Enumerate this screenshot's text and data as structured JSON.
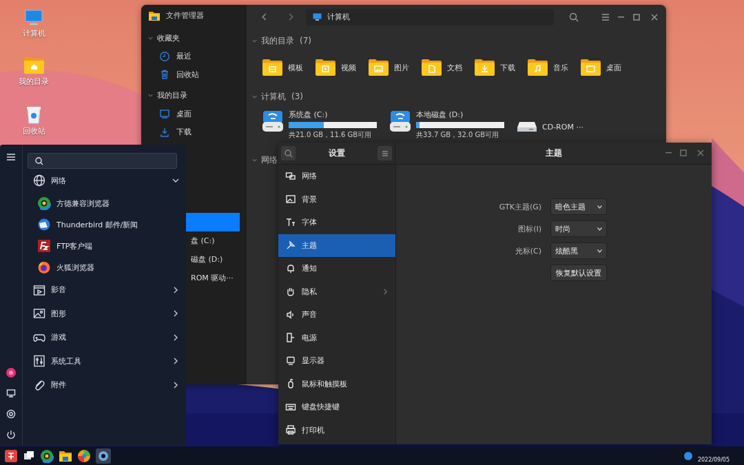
{
  "desktop_icons": [
    {
      "label": "计算机",
      "kind": "computer"
    },
    {
      "label": "我的目录",
      "kind": "home"
    },
    {
      "label": "回收站",
      "kind": "trash"
    }
  ],
  "file_manager": {
    "title": "文件管理器",
    "path": "计算机",
    "sidebar": [
      {
        "label": "收藏夹",
        "expanded": true,
        "children": [
          {
            "label": "最近",
            "kind": "recent"
          },
          {
            "label": "回收站",
            "kind": "trash"
          }
        ]
      },
      {
        "label": "我的目录",
        "expanded": true,
        "children": [
          {
            "label": "桌面",
            "kind": "desktop"
          },
          {
            "label": "下载",
            "kind": "download"
          }
        ]
      }
    ],
    "sidebar_partial": [
      {
        "selected": true
      },
      {
        "label": "盘 (C:)",
        "selected": false
      },
      {
        "label": "磁盘 (D:)",
        "selected": false
      },
      {
        "label": "ROM 驱动···",
        "selected": false
      }
    ],
    "sections": [
      {
        "title": "我的目录",
        "count": "(7)",
        "expanded": true,
        "folders": [
          {
            "label": "模板",
            "kind": "template"
          },
          {
            "label": "视频",
            "kind": "video"
          },
          {
            "label": "图片",
            "kind": "picture"
          },
          {
            "label": "文档",
            "kind": "document"
          },
          {
            "label": "下载",
            "kind": "download"
          },
          {
            "label": "音乐",
            "kind": "music"
          },
          {
            "label": "桌面",
            "kind": "desktop"
          }
        ]
      },
      {
        "title": "计算机",
        "count": "(3)",
        "expanded": true,
        "drives": [
          {
            "kind": "disk",
            "label": "系统盘 (C:)",
            "level": 0.4,
            "info": "共21.0 GB，11.6 GB可用"
          },
          {
            "kind": "disk",
            "label": "本地磁盘 (D:)",
            "level": 0.04,
            "info": "共33.7 GB，32.0 GB可用"
          },
          {
            "kind": "cdrom",
            "label": "CD-ROM ···"
          }
        ]
      },
      {
        "title": "网络",
        "expanded": true
      }
    ]
  },
  "start_menu": {
    "items": [
      {
        "label": "网络",
        "kind": "network",
        "expanded": true,
        "children": [
          {
            "label": "方德兼容浏览器",
            "kind": "browser"
          },
          {
            "label": "Thunderbird 邮件/新闻",
            "kind": "mail"
          },
          {
            "label": "FTP客户端",
            "kind": "ftp"
          },
          {
            "label": "火狐浏览器",
            "kind": "firefox"
          }
        ]
      },
      {
        "label": "影音",
        "kind": "media",
        "expanded": false
      },
      {
        "label": "图形",
        "kind": "graphics",
        "expanded": false
      },
      {
        "label": "游戏",
        "kind": "games",
        "expanded": false
      },
      {
        "label": "系统工具",
        "kind": "tools",
        "expanded": false
      },
      {
        "label": "附件",
        "kind": "accessories",
        "expanded": false
      }
    ]
  },
  "settings": {
    "title": "设置",
    "page_title": "主题",
    "nav": [
      {
        "label": "网络",
        "kind": "network",
        "selected": false
      },
      {
        "label": "背景",
        "kind": "background",
        "selected": false
      },
      {
        "label": "字体",
        "kind": "font",
        "selected": false
      },
      {
        "label": "主题",
        "kind": "theme",
        "selected": true
      },
      {
        "label": "通知",
        "kind": "notification",
        "selected": false
      },
      {
        "label": "隐私",
        "kind": "privacy",
        "selected": false,
        "has_submenu": true
      },
      {
        "label": "声音",
        "kind": "sound",
        "selected": false
      },
      {
        "label": "电源",
        "kind": "power",
        "selected": false
      },
      {
        "label": "显示器",
        "kind": "display",
        "selected": false
      },
      {
        "label": "鼠标和触摸板",
        "kind": "mouse",
        "selected": false
      },
      {
        "label": "键盘快捷键",
        "kind": "keyboard",
        "selected": false
      },
      {
        "label": "打印机",
        "kind": "printer",
        "selected": false
      }
    ],
    "options": [
      {
        "label": "GTK主题(G)",
        "value": "暗色主题"
      },
      {
        "label": "图标(I)",
        "value": "时尚"
      },
      {
        "label": "光标(C)",
        "value": "炫酷黑"
      }
    ],
    "reset_button": "恢复默认设置"
  },
  "taskbar": {
    "date": "2022/09/05"
  }
}
